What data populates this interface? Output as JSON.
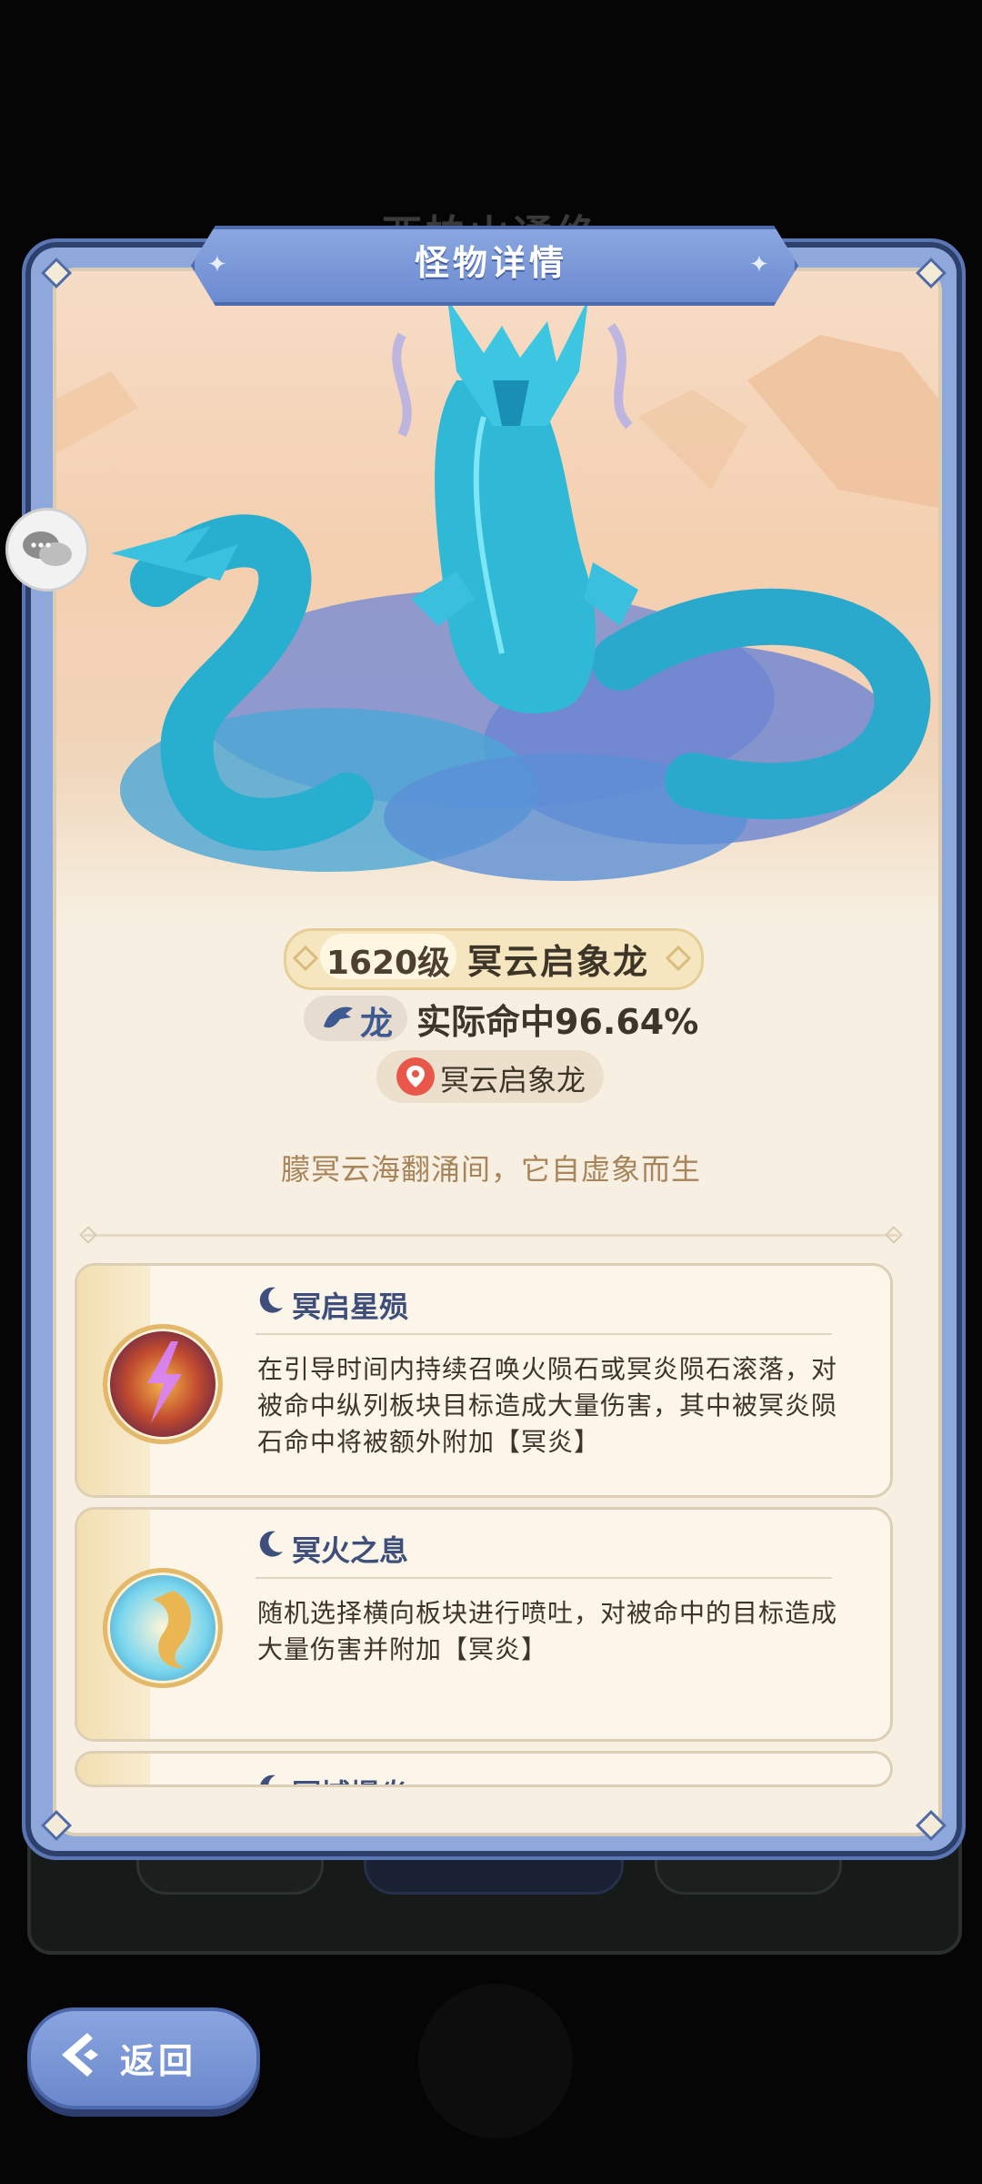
{
  "background": {
    "title": "西柏山通绝"
  },
  "modal": {
    "title": "怪物详情"
  },
  "monster": {
    "level": "1620级",
    "name": "冥云启象龙",
    "type": "龙",
    "hit_rate": "实际命中96.64%",
    "location": "冥云启象龙",
    "description": "朦冥云海翻涌间，它自虚象而生"
  },
  "skills": [
    {
      "name": "冥启星殒",
      "description": "在引导时间内持续召唤火陨石或冥炎陨石滚落，对被命中纵列板块目标造成大量伤害，其中被冥炎陨石命中将被额外附加【冥炎】",
      "icon": "meteor-icon"
    },
    {
      "name": "冥火之息",
      "description": "随机选择横向板块进行喷吐，对被命中的目标造成大量伤害并附加【冥炎】",
      "icon": "dragon-breath-icon"
    },
    {
      "name": "冥域爆炎",
      "description": "",
      "icon": "explosion-icon"
    }
  ],
  "buttons": {
    "back": "返回"
  },
  "colors": {
    "frame": "#8ea8dc",
    "panel": "#f7f0e2",
    "accent": "#3d4f7a",
    "dragon": "#2fb9d6"
  }
}
